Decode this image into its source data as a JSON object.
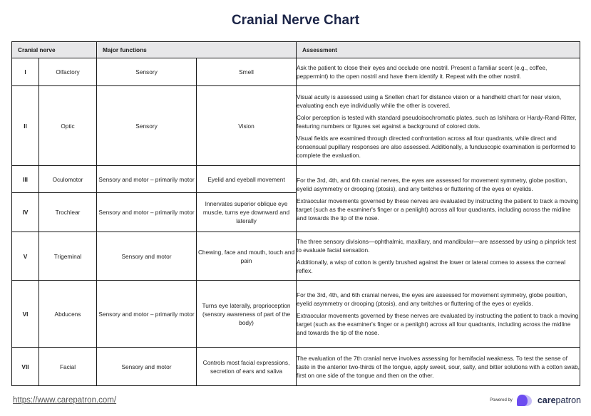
{
  "title": "Cranial Nerve Chart",
  "table": {
    "headers": {
      "cranial_nerve": "Cranial nerve",
      "major_functions": "Major functions",
      "assessment": "Assessment"
    },
    "rows": [
      {
        "numeral": "I",
        "name": "Olfactory",
        "type": "Sensory",
        "function": "Smell"
      },
      {
        "numeral": "II",
        "name": "Optic",
        "type": "Sensory",
        "function": "Vision"
      },
      {
        "numeral": "III",
        "name": "Oculomotor",
        "type": "Sensory and motor – primarily motor",
        "function": "Eyelid and eyeball movement"
      },
      {
        "numeral": "IV",
        "name": "Trochlear",
        "type": "Sensory and motor – primarily motor",
        "function": "Innervates superior oblique eye muscle, turns eye downward and laterally"
      },
      {
        "numeral": "V",
        "name": "Trigeminal",
        "type": "Sensory and motor",
        "function": "Chewing, face and mouth, touch and pain"
      },
      {
        "numeral": "VI",
        "name": "Abducens",
        "type": "Sensory and motor – primarily motor",
        "function": "Turns eye laterally, proprioception (sensory awareness of part of the body)"
      },
      {
        "numeral": "VII",
        "name": "Facial",
        "type": "Sensory and motor",
        "function": "Controls most facial expressions, secretion of ears and saliva"
      }
    ],
    "assessments": {
      "olfactory": [
        "Ask the patient to close their eyes and occlude one nostril. Present a familiar scent (e.g., coffee, peppermint) to the open nostril and have them identify it. Repeat with the other nostril."
      ],
      "optic": [
        "Visual acuity is assessed using a Snellen chart for distance vision or a handheld chart for near vision, evaluating each eye individually while the other is covered.",
        "Color perception is tested with standard pseudoisochromatic plates, such as Ishihara or Hardy-Rand-Ritter, featuring numbers or figures set against a background of colored dots.",
        "Visual fields are examined through directed confrontation across all four quadrants, while direct and consensual pupillary responses are also assessed. Additionally, a funduscopic examination is performed to complete the evaluation."
      ],
      "oculomotor_trochlear": [
        "For the 3rd, 4th, and 6th  cranial nerves, the eyes are assessed for movement symmetry, globe position, eyelid asymmetry or drooping (ptosis), and any twitches or fluttering of the eyes or eyelids.",
        "Extraocular movements governed by these nerves are evaluated by instructing the patient to track a moving target (such as the examiner's finger or a penlight) across all four quadrants, including across the midline and towards the tip of the nose."
      ],
      "trigeminal": [
        "The three sensory divisions—ophthalmic, maxillary, and mandibular—are assessed by using a pinprick test to evaluate facial sensation.",
        "Additionally, a wisp of cotton is gently brushed against the lower or lateral cornea to assess the corneal reflex."
      ],
      "abducens": [
        "For the 3rd, 4th, and 6th cranial nerves, the eyes are assessed for movement symmetry, globe position, eyelid asymmetry or drooping (ptosis), and any twitches or fluttering of the eyes or eyelids.",
        "Extraocular movements governed by these nerves are evaluated by instructing the patient to track a moving target (such as the examiner's finger or a penlight) across all four quadrants, including across the midline and towards the tip of the nose."
      ],
      "facial": [
        "The evaluation of the 7th cranial nerve involves assessing for hemifacial weakness. To test the sense of taste in the anterior two-thirds of the tongue, apply sweet, sour, salty, and bitter solutions with a cotton swab, first on one side of the tongue and then on the other."
      ]
    }
  },
  "footer": {
    "link": "https://www.carepatron.com/",
    "powered_by": "Powered by",
    "brand_bold": "care",
    "brand_rest": "patron",
    "logo_icon": "carepatron-logo-icon",
    "colors": {
      "brand_dark": "#1b2447",
      "logo_primary": "#6c4cf0",
      "logo_light": "#c6bcf7"
    }
  }
}
